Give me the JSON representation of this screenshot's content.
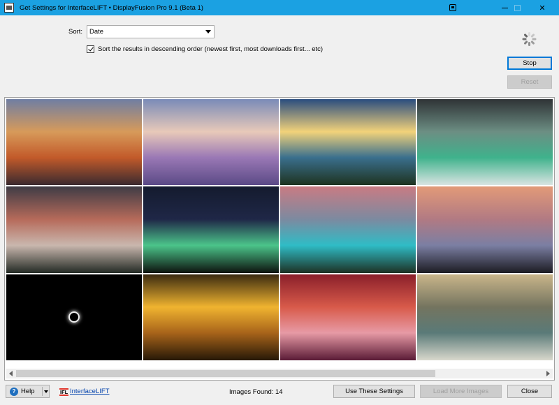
{
  "window": {
    "title": "Get Settings for InterfaceLIFT • DisplayFusion Pro 9.1 (Beta 1)"
  },
  "sort": {
    "label": "Sort:",
    "selected": "Date",
    "descending_label": "Sort the results in descending order (newest first, most downloads first... etc)",
    "descending_checked": true
  },
  "buttons": {
    "stop": "Stop",
    "reset": "Reset",
    "help": "Help",
    "use_settings": "Use These Settings",
    "load_more": "Load More Images",
    "close": "Close"
  },
  "footer": {
    "logo_text": "IFL",
    "link_text": "InterfaceLIFT",
    "images_found_label": "Images Found:",
    "images_found_count": "14"
  },
  "gallery": {
    "thumbnails": [
      {
        "name": "half-dome-sunset",
        "colors": [
          "#6f7ea3",
          "#d79a5a",
          "#c25a2a",
          "#3a2a2f"
        ]
      },
      {
        "name": "lavender-field-tree",
        "colors": [
          "#7a8bb8",
          "#e8c9b9",
          "#9a78b5",
          "#5b4a86"
        ]
      },
      {
        "name": "lake-sunrise-mountains",
        "colors": [
          "#2a4d7f",
          "#f2d27a",
          "#3a6f8d",
          "#1e3320"
        ]
      },
      {
        "name": "crashing-green-wave",
        "colors": [
          "#2f3336",
          "#6c8e83",
          "#3fb28c",
          "#d9e4e2"
        ]
      },
      {
        "name": "misty-forest-valley",
        "colors": [
          "#3f3c45",
          "#b66a5a",
          "#c9b7ae",
          "#232a24"
        ]
      },
      {
        "name": "aurora-night-sky",
        "colors": [
          "#141b2e",
          "#1f2747",
          "#4bc48a",
          "#0d120d"
        ]
      },
      {
        "name": "turquoise-lake-peaks",
        "colors": [
          "#c97b83",
          "#7c8aa0",
          "#2fbcc6",
          "#1d3124"
        ]
      },
      {
        "name": "pier-silhouettes-sunset",
        "colors": [
          "#e29a78",
          "#b17a83",
          "#7b7fa3",
          "#1c1b22"
        ]
      },
      {
        "name": "solar-eclipse",
        "colors": [
          "#000000",
          "#000000",
          "#000000",
          "#000000"
        ]
      },
      {
        "name": "golden-arches-reflection",
        "colors": [
          "#3a2a10",
          "#f0b430",
          "#a8641a",
          "#261807"
        ]
      },
      {
        "name": "antelope-canyon",
        "colors": [
          "#8a1f2a",
          "#d85a4a",
          "#e79aa5",
          "#5a1b36"
        ]
      },
      {
        "name": "rocky-coast-waves",
        "colors": [
          "#c9b58a",
          "#74745f",
          "#5a7a78",
          "#d8d8cc"
        ]
      }
    ]
  }
}
